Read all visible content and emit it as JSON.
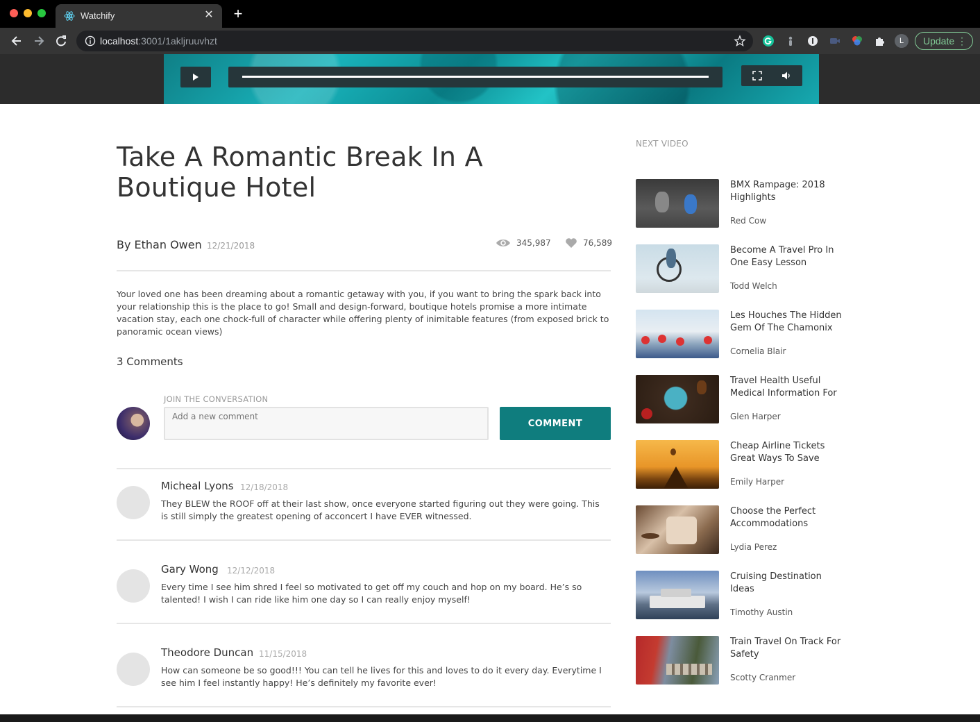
{
  "browser": {
    "tab_title": "Watchify",
    "url_host": "localhost",
    "url_path": ":3001/1akljruuvhzt",
    "profile_initial": "L",
    "update_label": "Update"
  },
  "article": {
    "title": "Take A Romantic Break In A Boutique Hotel",
    "byline": "By Ethan Owen",
    "date": "12/21/2018",
    "views": "345,987",
    "likes": "76,589",
    "description": "Your loved one has been dreaming about a romantic getaway with you, if you want to bring the spark back into your relationship this is the place to go! Small and design-forward, boutique hotels promise a more intimate vacation stay, each one chock-full of character while offering plenty of inimitable features (from exposed brick to panoramic ocean views)"
  },
  "comments_section": {
    "count_label": "3 Comments",
    "join_label": "JOIN THE CONVERSATION",
    "input_placeholder": "Add a new comment",
    "button_label": "COMMENT",
    "comments": [
      {
        "name": "Micheal Lyons",
        "date": "12/18/2018",
        "text": "They BLEW the ROOF off at their last show, once everyone started figuring out they were going. This is still simply the greatest opening of acconcert I have EVER witnessed."
      },
      {
        "name": "Gary Wong",
        "date": "12/12/2018",
        "text": "Every time I see him shred I feel so motivated to get off my couch and hop on my board. He’s so talented! I wish I can ride like him one day so I can really enjoy myself!"
      },
      {
        "name": "Theodore Duncan",
        "date": "11/15/2018",
        "text": "How can someone be so good!!! You can tell he lives for this and loves to do it every day. Everytime I see him I feel instantly happy! He’s definitely my favorite ever!"
      }
    ]
  },
  "sidebar": {
    "heading": "NEXT VIDEO",
    "videos": [
      {
        "title": "BMX Rampage: 2018 Highlights",
        "author": "Red Cow"
      },
      {
        "title": "Become A Travel Pro In One Easy Lesson",
        "author": "Todd Welch"
      },
      {
        "title": "Les Houches The Hidden Gem Of The Chamonix",
        "author": "Cornelia Blair"
      },
      {
        "title": "Travel Health Useful Medical Information For",
        "author": "Glen Harper"
      },
      {
        "title": "Cheap Airline Tickets Great Ways To Save",
        "author": "Emily Harper"
      },
      {
        "title": "Choose the Perfect Accommodations",
        "author": "Lydia Perez"
      },
      {
        "title": "Cruising Destination Ideas",
        "author": "Timothy Austin"
      },
      {
        "title": "Train Travel On Track For Safety",
        "author": "Scotty Cranmer"
      }
    ]
  },
  "colors": {
    "accent": "#0f7d7e",
    "update_green": "#81c995"
  }
}
